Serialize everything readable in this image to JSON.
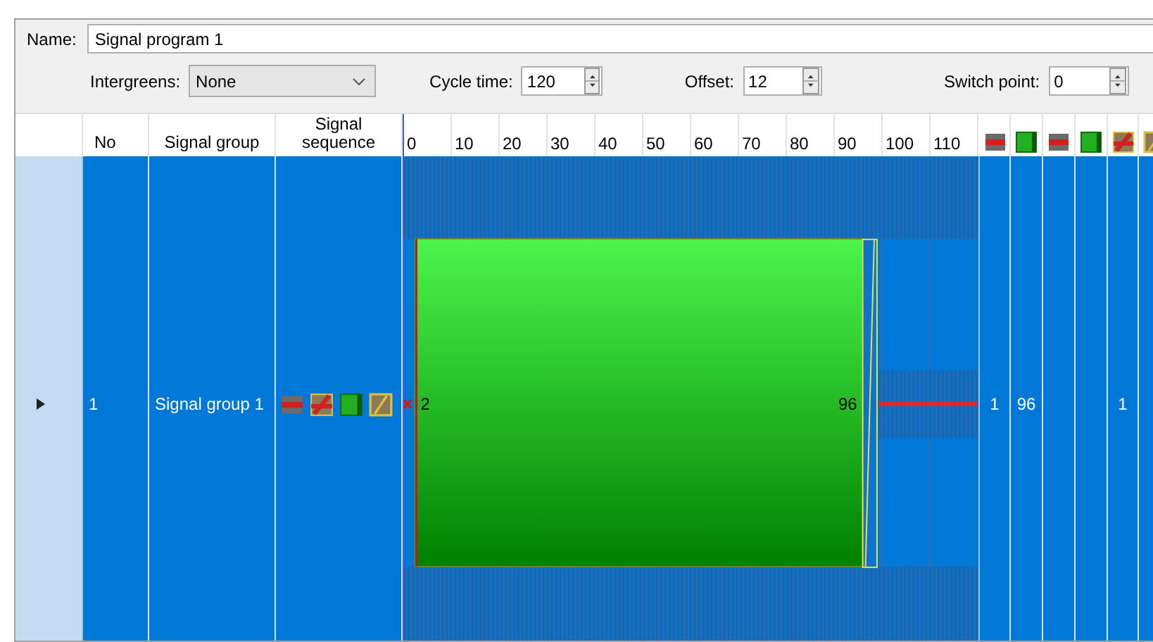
{
  "name_label": "Name:",
  "name_value": "Signal program 1",
  "intergreens": {
    "label": "Intergreens:",
    "value": "None"
  },
  "cycle_time": {
    "label": "Cycle time:",
    "value": "120"
  },
  "offset": {
    "label": "Offset:",
    "value": "12"
  },
  "switch_point": {
    "label": "Switch point:",
    "value": "0"
  },
  "columns": [
    "No",
    "Signal group",
    "Signal\nsequence"
  ],
  "ticks": [
    "0",
    "10",
    "20",
    "30",
    "40",
    "50",
    "60",
    "70",
    "80",
    "90",
    "100",
    "110"
  ],
  "extra_columns": [
    {
      "kind": "red"
    },
    {
      "kind": "green"
    },
    {
      "kind": "red"
    },
    {
      "kind": "green"
    },
    {
      "kind": "red-amber"
    },
    {
      "kind": "amber"
    }
  ],
  "rows": [
    {
      "selected": true,
      "no": "1",
      "group": "Signal group 1",
      "sequence": [
        {
          "kind": "red"
        },
        {
          "kind": "red-amber"
        },
        {
          "kind": "green"
        },
        {
          "kind": "amber"
        }
      ],
      "green_start": "2",
      "green_end": "96",
      "extra_cells": [
        "1",
        "96",
        "",
        "",
        "1",
        ""
      ]
    }
  ]
}
